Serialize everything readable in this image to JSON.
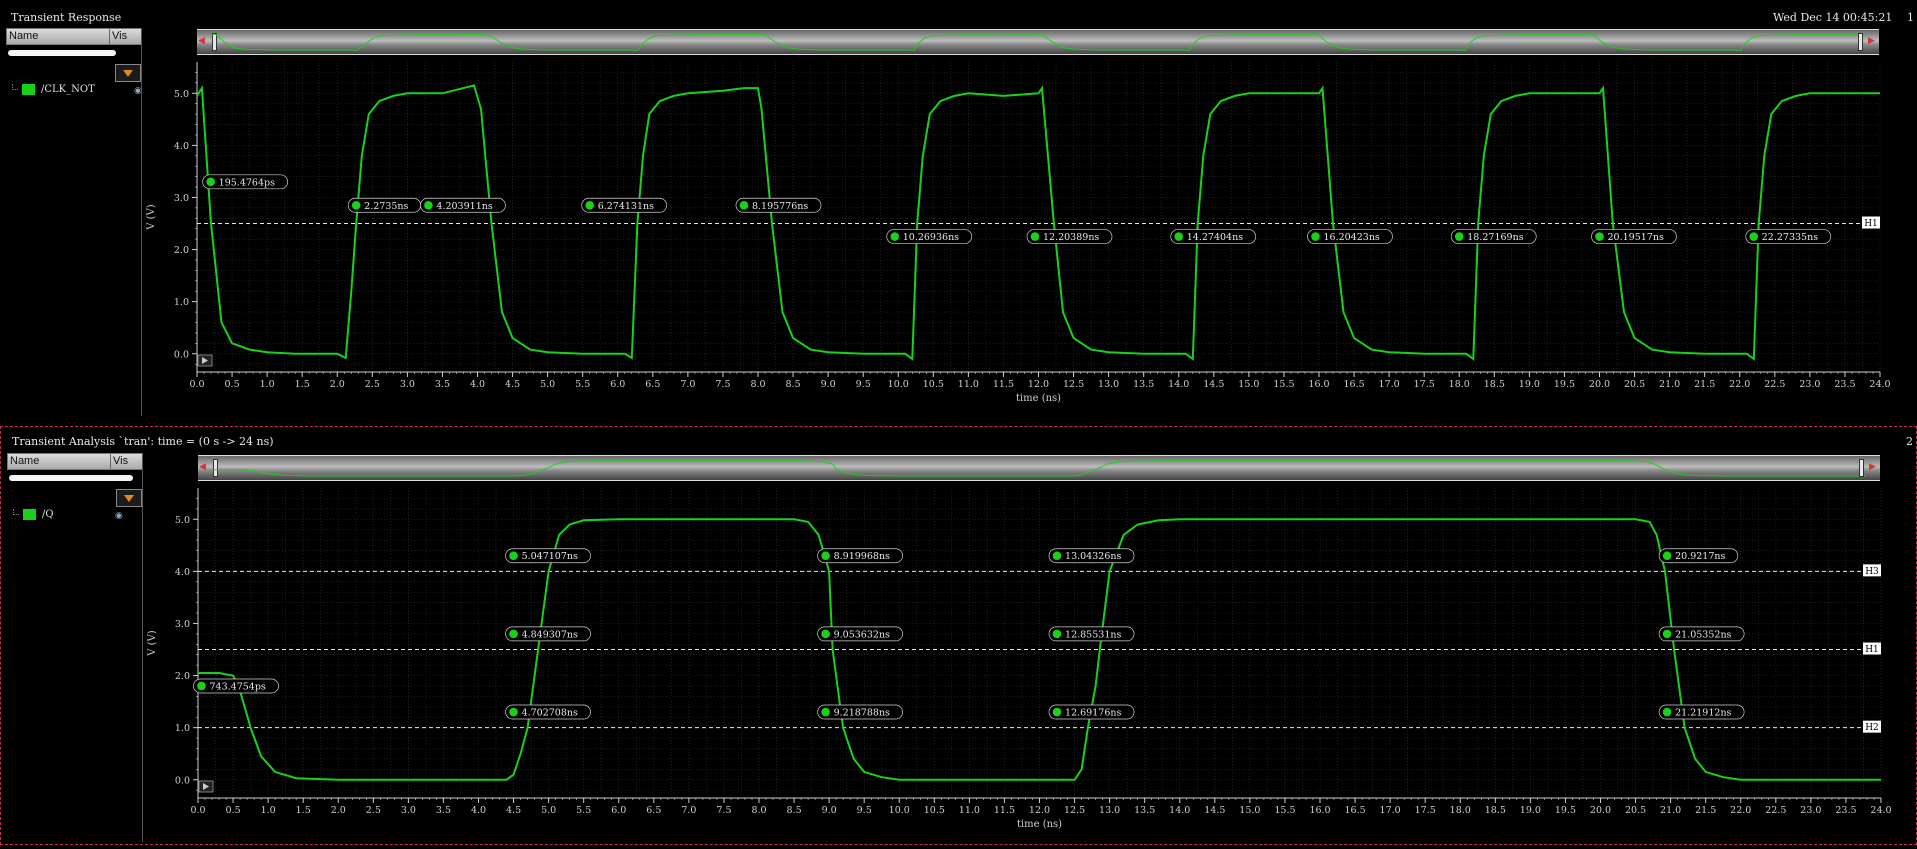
{
  "header": {
    "date": "Wed Dec 14 00:45:21"
  },
  "panels": [
    {
      "title": "Transient Response",
      "number": "1",
      "columns": {
        "name": "Name",
        "vis": "Vis"
      },
      "signal": "/CLK_NOT"
    },
    {
      "title": "Transient Analysis `tran': time = (0 s -> 24 ns)",
      "number": "2",
      "columns": {
        "name": "Name",
        "vis": "Vis"
      },
      "signal": "/Q"
    }
  ],
  "colors": {
    "trace": "#19d119",
    "grid": "#2a2a2a",
    "axis": "#cfcfcf",
    "marker_line": "#e8e8e8",
    "panel_border": "#c0304a"
  },
  "icons": [
    "filter-icon",
    "eye-icon",
    "play-icon",
    "scroll-left-arrow-icon",
    "scroll-right-arrow-icon"
  ],
  "chart_data": [
    {
      "type": "line",
      "xlabel": "time (ns)",
      "ylabel": "V (V)",
      "xlim": [
        0,
        24
      ],
      "ylim": [
        -0.35,
        5.6
      ],
      "x_ticks": [
        "0.0",
        "0.5",
        "1.0",
        "1.5",
        "2.0",
        "2.5",
        "3.0",
        "3.5",
        "4.0",
        "4.5",
        "5.0",
        "5.5",
        "6.0",
        "6.5",
        "7.0",
        "7.5",
        "8.0",
        "8.5",
        "9.0",
        "9.5",
        "10.0",
        "10.5",
        "11.0",
        "11.5",
        "12.0",
        "12.5",
        "13.0",
        "13.5",
        "14.0",
        "14.5",
        "15.0",
        "15.5",
        "16.0",
        "16.5",
        "17.0",
        "17.5",
        "18.0",
        "18.5",
        "19.0",
        "19.5",
        "20.0",
        "20.5",
        "21.0",
        "21.5",
        "22.0",
        "22.5",
        "23.0",
        "23.5",
        "24.0"
      ],
      "y_ticks": [
        "0.0",
        "1.0",
        "2.0",
        "3.0",
        "4.0",
        "5.0"
      ],
      "grid": true,
      "series": [
        {
          "name": "/CLK_NOT",
          "x": [
            0,
            0.07,
            0.2,
            0.35,
            0.5,
            0.75,
            1.0,
            1.4,
            2.0,
            2.12,
            2.2,
            2.27,
            2.35,
            2.45,
            2.6,
            2.8,
            3.0,
            3.5,
            3.95,
            4.05,
            4.2,
            4.35,
            4.5,
            4.75,
            5.0,
            5.5,
            6.1,
            6.2,
            6.28,
            6.36,
            6.45,
            6.6,
            6.8,
            7.0,
            7.5,
            7.8,
            8.0,
            8.05,
            8.2,
            8.35,
            8.5,
            8.75,
            9.0,
            9.5,
            10.1,
            10.2,
            10.27,
            10.35,
            10.45,
            10.6,
            10.8,
            11.0,
            11.5,
            12.0,
            12.05,
            12.22,
            12.35,
            12.5,
            12.75,
            13.0,
            13.5,
            14.1,
            14.2,
            14.27,
            14.35,
            14.45,
            14.6,
            14.8,
            15.0,
            15.5,
            16.0,
            16.05,
            16.2,
            16.35,
            16.5,
            16.75,
            17.0,
            17.5,
            18.1,
            18.2,
            18.27,
            18.35,
            18.45,
            18.6,
            18.8,
            19.0,
            19.5,
            20.0,
            20.05,
            20.19,
            20.35,
            20.5,
            20.75,
            21.0,
            21.5,
            22.1,
            22.2,
            22.27,
            22.35,
            22.45,
            22.6,
            22.8,
            23.0,
            23.5,
            24.0
          ],
          "values": [
            4.95,
            5.1,
            2.5,
            0.6,
            0.2,
            0.08,
            0.03,
            0.0,
            0.0,
            -0.08,
            1.2,
            2.5,
            3.8,
            4.6,
            4.85,
            4.95,
            5.0,
            5.0,
            5.15,
            4.7,
            2.5,
            0.8,
            0.3,
            0.08,
            0.03,
            0.0,
            0.0,
            -0.08,
            2.5,
            3.8,
            4.6,
            4.85,
            4.95,
            5.0,
            5.05,
            5.1,
            5.1,
            4.7,
            2.5,
            0.8,
            0.3,
            0.08,
            0.03,
            0.0,
            0.0,
            -0.1,
            2.5,
            3.8,
            4.6,
            4.85,
            4.95,
            5.0,
            4.95,
            5.0,
            5.1,
            2.5,
            0.8,
            0.3,
            0.08,
            0.03,
            0.0,
            0.0,
            -0.1,
            2.5,
            3.8,
            4.6,
            4.85,
            4.95,
            5.0,
            5.0,
            5.0,
            5.1,
            2.5,
            0.8,
            0.3,
            0.08,
            0.03,
            0.0,
            0.0,
            -0.1,
            2.5,
            3.8,
            4.6,
            4.85,
            4.95,
            5.0,
            5.0,
            5.0,
            5.1,
            2.5,
            0.8,
            0.3,
            0.08,
            0.03,
            0.0,
            0.0,
            -0.1,
            2.5,
            3.8,
            4.6,
            4.85,
            4.95,
            5.0,
            5.0,
            5.0
          ]
        }
      ],
      "hlines": [
        {
          "label": "H1",
          "y": 2.5
        }
      ],
      "markers": [
        {
          "label": "195.4764ps",
          "x": 0.195,
          "y": 3.3
        },
        {
          "label": "2.2735ns",
          "x": 2.27,
          "y": 2.85
        },
        {
          "label": "4.203911ns",
          "x": 3.3,
          "y": 2.85
        },
        {
          "label": "6.274131ns",
          "x": 5.6,
          "y": 2.85
        },
        {
          "label": "8.195776ns",
          "x": 7.8,
          "y": 2.85
        },
        {
          "label": "10.26936ns",
          "x": 9.95,
          "y": 2.25
        },
        {
          "label": "12.20389ns",
          "x": 11.95,
          "y": 2.25
        },
        {
          "label": "14.27404ns",
          "x": 14.0,
          "y": 2.25
        },
        {
          "label": "16.20423ns",
          "x": 15.95,
          "y": 2.25
        },
        {
          "label": "18.27169ns",
          "x": 18.0,
          "y": 2.25
        },
        {
          "label": "20.19517ns",
          "x": 20.0,
          "y": 2.25
        },
        {
          "label": "22.27335ns",
          "x": 22.2,
          "y": 2.25
        }
      ]
    },
    {
      "type": "line",
      "xlabel": "time (ns)",
      "ylabel": "V (V)",
      "xlim": [
        0,
        24
      ],
      "ylim": [
        -0.35,
        5.6
      ],
      "x_ticks": [
        "0.0",
        "0.5",
        "1.0",
        "1.5",
        "2.0",
        "2.5",
        "3.0",
        "3.5",
        "4.0",
        "4.5",
        "5.0",
        "5.5",
        "6.0",
        "6.5",
        "7.0",
        "7.5",
        "8.0",
        "8.5",
        "9.0",
        "9.5",
        "10.0",
        "10.5",
        "11.0",
        "11.5",
        "12.0",
        "12.5",
        "13.0",
        "13.5",
        "14.0",
        "14.5",
        "15.0",
        "15.5",
        "16.0",
        "16.5",
        "17.0",
        "17.5",
        "18.0",
        "18.5",
        "19.0",
        "19.5",
        "20.0",
        "20.5",
        "21.0",
        "21.5",
        "22.0",
        "22.5",
        "23.0",
        "23.5",
        "24.0"
      ],
      "y_ticks": [
        "0.0",
        "1.0",
        "2.0",
        "3.0",
        "4.0",
        "5.0"
      ],
      "grid": true,
      "series": [
        {
          "name": "/Q",
          "x": [
            0,
            0.3,
            0.5,
            0.6,
            0.75,
            0.9,
            1.1,
            1.4,
            2.0,
            4.4,
            4.5,
            4.6,
            4.7,
            4.85,
            5.0,
            5.15,
            5.3,
            5.5,
            6.0,
            7.0,
            8.5,
            8.7,
            8.85,
            9.0,
            9.05,
            9.2,
            9.35,
            9.5,
            9.75,
            10.0,
            11.0,
            12.5,
            12.6,
            12.69,
            12.8,
            12.86,
            13.0,
            13.2,
            13.4,
            13.7,
            14.0,
            16.0,
            18.5,
            20.5,
            20.7,
            20.8,
            20.92,
            21.05,
            21.2,
            21.35,
            21.5,
            21.75,
            22.0,
            24.0
          ],
          "values": [
            2.05,
            2.05,
            2.0,
            1.7,
            1.0,
            0.45,
            0.15,
            0.03,
            0.0,
            0.0,
            0.1,
            0.5,
            1.0,
            2.5,
            4.0,
            4.7,
            4.9,
            4.98,
            5.0,
            5.0,
            5.0,
            4.95,
            4.7,
            4.0,
            2.5,
            1.0,
            0.4,
            0.15,
            0.05,
            0.0,
            0.0,
            0.0,
            0.2,
            1.0,
            1.8,
            2.5,
            4.0,
            4.7,
            4.9,
            4.98,
            5.0,
            5.0,
            5.0,
            5.0,
            4.95,
            4.7,
            4.0,
            2.5,
            1.0,
            0.4,
            0.15,
            0.05,
            0.0,
            0.0
          ]
        }
      ],
      "hlines": [
        {
          "label": "H3",
          "y": 4.0
        },
        {
          "label": "H1",
          "y": 2.5
        },
        {
          "label": "H2",
          "y": 1.0
        }
      ],
      "markers": [
        {
          "label": "743.4754ps",
          "x": 0.05,
          "y": 1.8
        },
        {
          "label": "5.047107ns",
          "x": 4.5,
          "y": 4.3
        },
        {
          "label": "4.849307ns",
          "x": 4.5,
          "y": 2.8
        },
        {
          "label": "4.702708ns",
          "x": 4.5,
          "y": 1.3
        },
        {
          "label": "8.919968ns",
          "x": 8.95,
          "y": 4.3
        },
        {
          "label": "9.053632ns",
          "x": 8.95,
          "y": 2.8
        },
        {
          "label": "9.218788ns",
          "x": 8.95,
          "y": 1.3
        },
        {
          "label": "13.04326ns",
          "x": 12.25,
          "y": 4.3
        },
        {
          "label": "12.85531ns",
          "x": 12.25,
          "y": 2.8
        },
        {
          "label": "12.69176ns",
          "x": 12.25,
          "y": 1.3
        },
        {
          "label": "20.9217ns",
          "x": 20.95,
          "y": 4.3
        },
        {
          "label": "21.05352ns",
          "x": 20.95,
          "y": 2.8
        },
        {
          "label": "21.21912ns",
          "x": 20.95,
          "y": 1.3
        }
      ]
    }
  ]
}
